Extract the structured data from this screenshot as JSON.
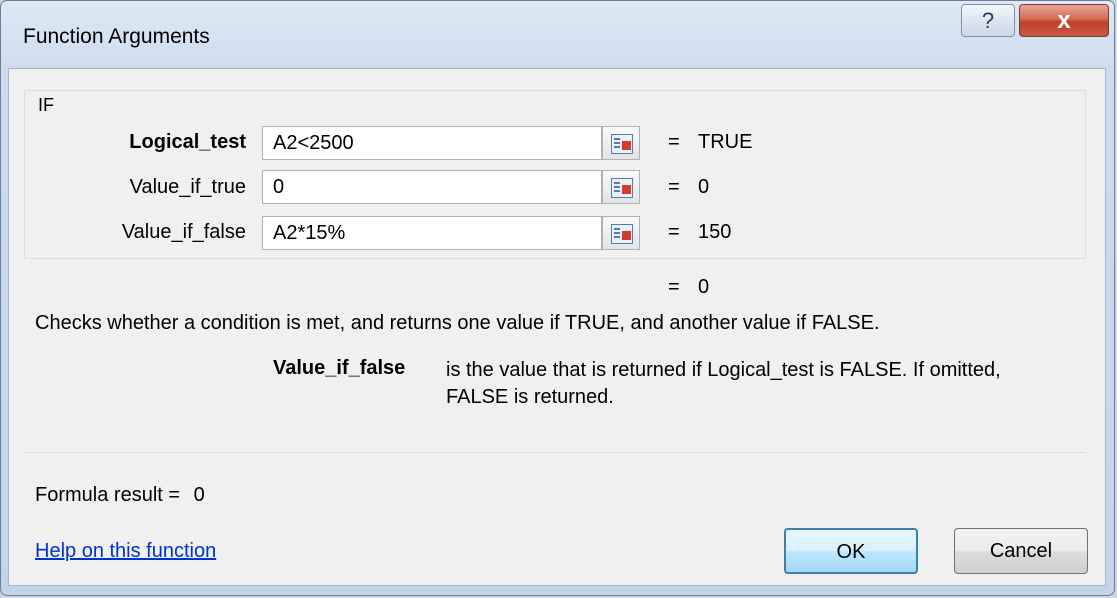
{
  "window": {
    "title": "Function Arguments",
    "help_icon": "?",
    "close_icon": "x"
  },
  "function_group": {
    "name": "IF",
    "arguments": [
      {
        "label": "Logical_test",
        "bold": true,
        "value": "A2<2500",
        "result": "TRUE"
      },
      {
        "label": "Value_if_true",
        "bold": false,
        "value": "0",
        "result": "0"
      },
      {
        "label": "Value_if_false",
        "bold": false,
        "value": "A2*15%",
        "result": "150"
      }
    ]
  },
  "equals_sign": "=",
  "overall_result": "0",
  "description": "Checks whether a condition is met, and returns one value if TRUE, and another value if FALSE.",
  "argument_help": {
    "name": "Value_if_false",
    "text": "is the value that is returned if Logical_test is FALSE. If omitted, FALSE is returned."
  },
  "formula_result": {
    "label": "Formula result =",
    "value": "0"
  },
  "help_link": "Help on this function",
  "buttons": {
    "ok": "OK",
    "cancel": "Cancel"
  }
}
